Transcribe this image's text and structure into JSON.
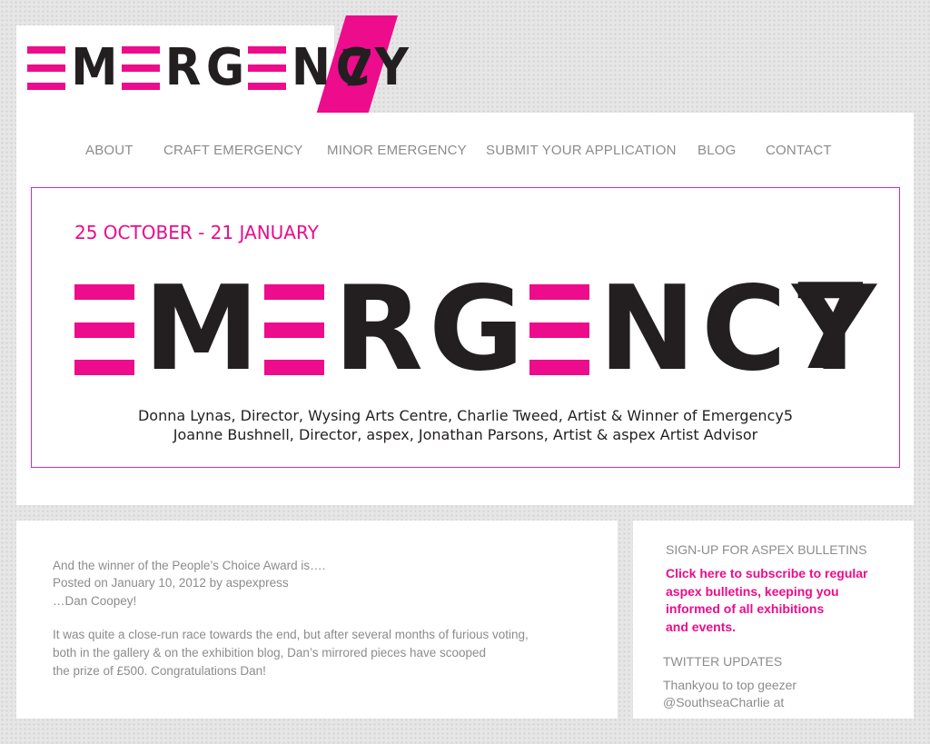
{
  "brand": {
    "logo_letters": [
      "M",
      "R",
      "G",
      "N",
      "C",
      "Y"
    ],
    "logo_seven": "7",
    "accent_color": "#ec0c8c",
    "text_color": "#231f20"
  },
  "nav": {
    "items": [
      "ABOUT",
      "CRAFT EMERGENCY",
      "MINOR EMERGENCY",
      "SUBMIT YOUR APPLICATION",
      "BLOG",
      "CONTACT"
    ]
  },
  "hero": {
    "dates": "25 OCTOBER - 21 JANUARY",
    "title_seven": "7",
    "credits_line1": "Donna Lynas, Director, Wysing Arts Centre, Charlie Tweed, Artist & Winner of Emergency5",
    "credits_line2": "Joanne Bushnell, Director, aspex, Jonathan Parsons, Artist & aspex Artist Advisor"
  },
  "post": {
    "title": "And the winner of the People’s Choice Award is….",
    "meta": "Posted on January 10, 2012 by aspexpress",
    "lead": "…Dan Coopey!",
    "body_line1": "It was quite a close-run race towards the end, but after several months of furious voting,",
    "body_line2": "both in the gallery & on the exhibition blog, Dan’s mirrored pieces have scooped",
    "body_line3": "the prize of £500. Congratulations Dan!"
  },
  "sidebar": {
    "signup_heading": "SIGN-UP FOR ASPEX BULLETINS",
    "signup_line1": "Click here to subscribe to regular",
    "signup_line2": "aspex bulletins, keeping you",
    "signup_line3": "informed of all exhibitions",
    "signup_line4": "and events.",
    "twitter_heading": "TWITTER UPDATES",
    "tweet_line1": "Thankyou to top geezer",
    "tweet_line2": "@SouthseaCharlie at"
  }
}
